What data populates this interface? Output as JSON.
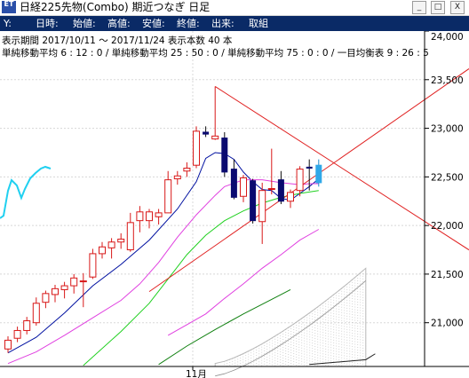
{
  "window": {
    "icon_text": "ET",
    "title": "日経225先物(Combo) 期近つなぎ 日足",
    "buttons": [
      "_",
      "□",
      "X"
    ]
  },
  "info_bar": {
    "cells": [
      {
        "label": "Y:"
      },
      {
        "label": "日時:"
      },
      {
        "label": "始値:"
      },
      {
        "label": "高値:"
      },
      {
        "label": "安値:"
      },
      {
        "label": "終値:"
      },
      {
        "label": "出来:"
      },
      {
        "label": "取組"
      }
    ]
  },
  "chart_header": {
    "line1": "表示期間 2017/10/11 〜 2017/11/24 表示本数 40 本",
    "line2": "単純移動平均 6 : 12 : 0 / 単純移動平均 25 : 50 : 0 / 単純移動平均 75 : 0 : 0 / 一目均衡表 9 : 26 : 5"
  },
  "colors": {
    "up_candle": "#d81818",
    "down_candle": "#0a0a70",
    "latest_candle": "#30a8e8",
    "ma6": "#0010a0",
    "ma12": "#e040e0",
    "ma25": "#20d020",
    "ma50": "#e040e0",
    "ma75": "#108010",
    "cloud": "#b8b8b8",
    "trendline": "#e02020",
    "background": "#ffffff",
    "grid": "#d8d8d8"
  },
  "chart_data": {
    "type": "candlestick",
    "title": "日経225先物(Combo) 期近つなぎ 日足",
    "period": "2017/10/11 〜 2017/11/24",
    "bars_shown": 40,
    "ylim": [
      20550,
      24000
    ],
    "y_ticks": [
      21000,
      21500,
      22000,
      22500,
      23000,
      23500,
      24000
    ],
    "x_tick_labels": [
      {
        "index": 20,
        "label": "11月"
      }
    ],
    "grid": true,
    "candles": [
      {
        "o": 20730,
        "h": 20860,
        "l": 20690,
        "c": 20820
      },
      {
        "o": 20840,
        "h": 20960,
        "l": 20800,
        "c": 20920
      },
      {
        "o": 20920,
        "h": 21060,
        "l": 20880,
        "c": 21020
      },
      {
        "o": 21000,
        "h": 21260,
        "l": 20970,
        "c": 21200
      },
      {
        "o": 21210,
        "h": 21330,
        "l": 21150,
        "c": 21300
      },
      {
        "o": 21290,
        "h": 21390,
        "l": 21210,
        "c": 21350
      },
      {
        "o": 21340,
        "h": 21420,
        "l": 21250,
        "c": 21380
      },
      {
        "o": 21380,
        "h": 21500,
        "l": 21300,
        "c": 21460
      },
      {
        "o": 21430,
        "h": 21510,
        "l": 21160,
        "c": 21430
      },
      {
        "o": 21470,
        "h": 21760,
        "l": 21450,
        "c": 21710
      },
      {
        "o": 21710,
        "h": 21830,
        "l": 21660,
        "c": 21780
      },
      {
        "o": 21770,
        "h": 21870,
        "l": 21660,
        "c": 21830
      },
      {
        "o": 21830,
        "h": 21920,
        "l": 21760,
        "c": 21860
      },
      {
        "o": 21750,
        "h": 22130,
        "l": 21730,
        "c": 22030
      },
      {
        "o": 22050,
        "h": 22200,
        "l": 21930,
        "c": 22140
      },
      {
        "o": 22050,
        "h": 22170,
        "l": 21970,
        "c": 22140
      },
      {
        "o": 22090,
        "h": 22170,
        "l": 22010,
        "c": 22130
      },
      {
        "o": 22130,
        "h": 22560,
        "l": 22130,
        "c": 22470
      },
      {
        "o": 22480,
        "h": 22560,
        "l": 22420,
        "c": 22510
      },
      {
        "o": 22560,
        "h": 22650,
        "l": 22500,
        "c": 22590
      },
      {
        "o": 22620,
        "h": 23020,
        "l": 22590,
        "c": 22970
      },
      {
        "o": 22960,
        "h": 23020,
        "l": 22910,
        "c": 22940
      },
      {
        "o": 22890,
        "h": 23430,
        "l": 22880,
        "c": 22920
      },
      {
        "o": 22900,
        "h": 22960,
        "l": 22500,
        "c": 22550
      },
      {
        "o": 22580,
        "h": 22680,
        "l": 22270,
        "c": 22290
      },
      {
        "o": 22300,
        "h": 22520,
        "l": 22240,
        "c": 22490
      },
      {
        "o": 22460,
        "h": 22480,
        "l": 22020,
        "c": 22050
      },
      {
        "o": 22040,
        "h": 22440,
        "l": 21810,
        "c": 22360
      },
      {
        "o": 22380,
        "h": 22790,
        "l": 22320,
        "c": 22380
      },
      {
        "o": 22470,
        "h": 22560,
        "l": 22220,
        "c": 22250
      },
      {
        "o": 22250,
        "h": 22370,
        "l": 22180,
        "c": 22340
      },
      {
        "o": 22360,
        "h": 22610,
        "l": 22300,
        "c": 22580
      },
      {
        "o": 22600,
        "h": 22680,
        "l": 22360,
        "c": 22590
      },
      {
        "o": 22440,
        "h": 22680,
        "l": 22400,
        "c": 22620
      }
    ],
    "moving_averages": [
      {
        "name": "MA6",
        "color": "#0010a0",
        "points": [
          [
            0,
            20690
          ],
          [
            3,
            20850
          ],
          [
            6,
            21100
          ],
          [
            9,
            21380
          ],
          [
            12,
            21600
          ],
          [
            15,
            21850
          ],
          [
            18,
            22170
          ],
          [
            20,
            22450
          ],
          [
            21,
            22690
          ],
          [
            22,
            22750
          ],
          [
            23,
            22740
          ],
          [
            24,
            22680
          ],
          [
            25,
            22550
          ],
          [
            26,
            22450
          ],
          [
            27,
            22370
          ],
          [
            28,
            22360
          ],
          [
            29,
            22280
          ],
          [
            30,
            22260
          ],
          [
            31,
            22330
          ],
          [
            32,
            22400
          ],
          [
            33,
            22480
          ]
        ]
      },
      {
        "name": "MA12",
        "color": "#e040e0",
        "points": [
          [
            0,
            20580
          ],
          [
            3,
            20700
          ],
          [
            6,
            20870
          ],
          [
            9,
            21050
          ],
          [
            12,
            21230
          ],
          [
            14,
            21400
          ],
          [
            16,
            21620
          ],
          [
            18,
            21880
          ],
          [
            20,
            22110
          ],
          [
            22,
            22310
          ],
          [
            23,
            22400
          ],
          [
            25,
            22470
          ],
          [
            27,
            22470
          ],
          [
            29,
            22440
          ],
          [
            31,
            22420
          ],
          [
            32,
            22430
          ],
          [
            33,
            22430
          ]
        ]
      },
      {
        "name": "MA25",
        "color": "#20d020",
        "points": [
          [
            8,
            20560
          ],
          [
            12,
            20910
          ],
          [
            15,
            21200
          ],
          [
            17,
            21450
          ],
          [
            19,
            21700
          ],
          [
            21,
            21900
          ],
          [
            23,
            22050
          ],
          [
            25,
            22150
          ],
          [
            27,
            22230
          ],
          [
            29,
            22290
          ],
          [
            31,
            22330
          ],
          [
            33,
            22360
          ]
        ]
      },
      {
        "name": "MA50",
        "color": "#e040e0",
        "points": [
          [
            17,
            20870
          ],
          [
            19,
            20980
          ],
          [
            21,
            21090
          ],
          [
            23,
            21250
          ],
          [
            25,
            21400
          ],
          [
            27,
            21560
          ],
          [
            29,
            21700
          ],
          [
            31,
            21850
          ],
          [
            33,
            21960
          ]
        ]
      },
      {
        "name": "MA75",
        "color": "#108010",
        "points": [
          [
            16,
            20570
          ],
          [
            19,
            20760
          ],
          [
            22,
            20930
          ],
          [
            25,
            21090
          ],
          [
            28,
            21240
          ],
          [
            30,
            21340
          ]
        ]
      }
    ],
    "trendlines": [
      {
        "from": [
          22,
          23430
        ],
        "to": [
          39,
          22370
        ]
      },
      {
        "from": [
          15,
          21320
        ],
        "to": [
          39,
          22940
        ]
      }
    ],
    "legend": "none"
  }
}
